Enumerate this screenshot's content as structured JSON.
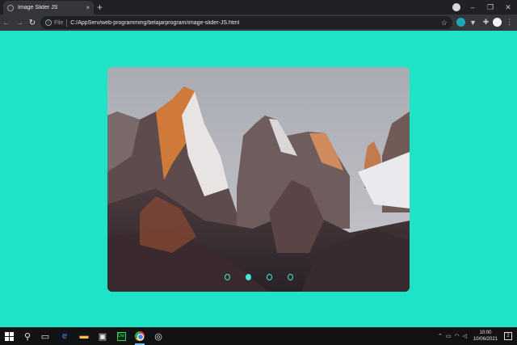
{
  "browser": {
    "tab_title": "Image Slider JS",
    "tab_close": "×",
    "new_tab": "+",
    "file_label": "File",
    "url": "C:/AppServ/web-programming/belajarprogram/image-slider-JS.html",
    "window_controls": {
      "minimize": "–",
      "maximize": "❐",
      "close": "✕"
    }
  },
  "slider": {
    "image_subject": "mountain peaks at sunrise",
    "dots": [
      {
        "active": false
      },
      {
        "active": true
      },
      {
        "active": false
      },
      {
        "active": false
      }
    ],
    "accent_color": "#41e8d6",
    "background_color": "#1ee3c7"
  },
  "taskbar": {
    "time": "10:00",
    "date": "10/06/2021",
    "dreamweaver_label": "Dw",
    "notification_count": "2"
  }
}
